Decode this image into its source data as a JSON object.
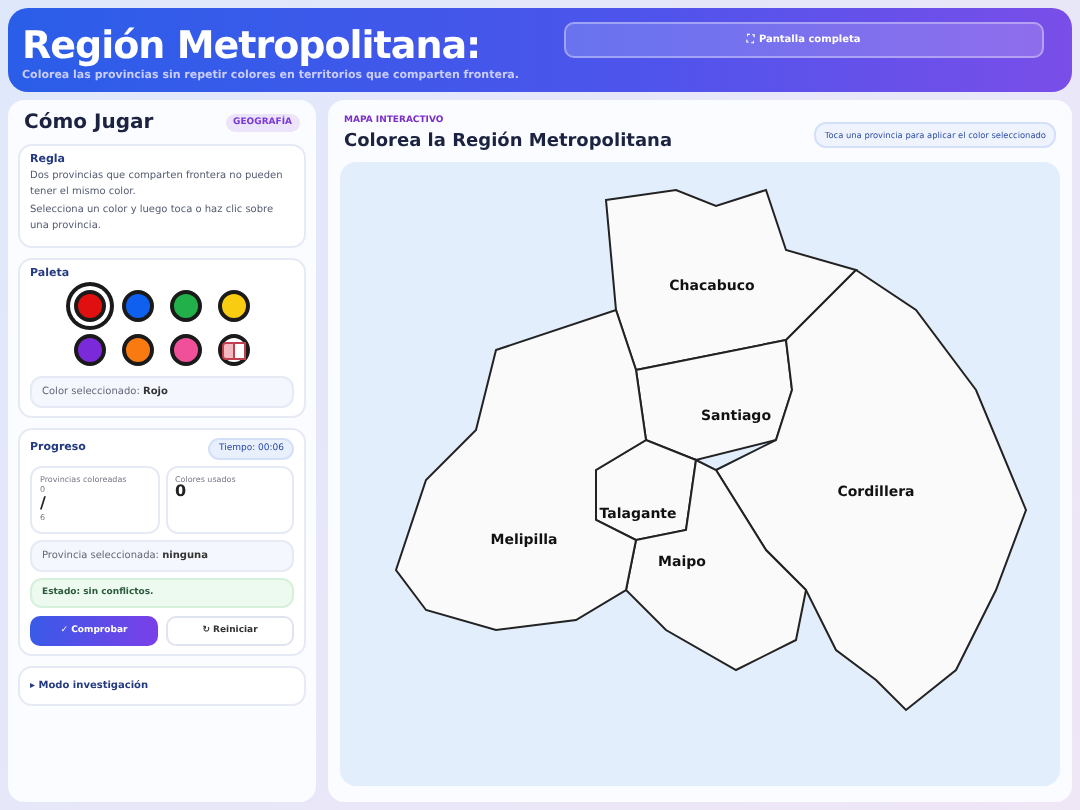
{
  "header": {
    "title": "Región Metropolitana:",
    "subtitle": "Colorea las provincias sin repetir colores en territorios que comparten frontera.",
    "fullscreen_button": "⛶ Pantalla completa"
  },
  "sidebar": {
    "title": "Cómo Jugar",
    "badge": "GEOGRAFÍA",
    "rule": {
      "heading": "Regla",
      "texts": [
        "Dos provincias que comparten frontera no pueden tener el mismo color.",
        "Selecciona un color y luego toca o haz clic sobre una provincia."
      ]
    },
    "palette": {
      "heading": "Paleta",
      "swatches": [
        {
          "kind": "color",
          "color": "#e01010",
          "selected": true
        },
        {
          "kind": "color",
          "color": "#1060f0",
          "selected": false
        },
        {
          "kind": "color",
          "color": "#22b04a",
          "selected": false
        },
        {
          "kind": "color",
          "color": "#f8cc10",
          "selected": false
        },
        {
          "kind": "color",
          "color": "#7a2ad8",
          "selected": false
        },
        {
          "kind": "color",
          "color": "#f87a10",
          "selected": false
        },
        {
          "kind": "color",
          "color": "#f0509a",
          "selected": false
        },
        {
          "kind": "eraser",
          "selected": false
        }
      ],
      "selected_label": "Color seleccionado:",
      "selected_value": "Rojo"
    },
    "progress": {
      "heading": "Progreso",
      "timer": "Tiempo: 00:06",
      "stats": [
        {
          "label": "Provincias coloreadas",
          "lines": [
            "0",
            "/",
            "6"
          ]
        },
        {
          "label": "Colores usados",
          "lines": [
            "0"
          ]
        }
      ],
      "province_label": "Provincia seleccionada:",
      "province_value": "ninguna",
      "status": "Estado: sin conflictos.",
      "check_button": "✓ Comprobar",
      "reset_button": "↻ Reiniciar"
    },
    "details": "▸ Modo investigación"
  },
  "map": {
    "kicker": "MAPA INTERACTIVO",
    "title": "Colorea la Región Metropolitana",
    "hint": "Toca una provincia para aplicar el color seleccionado",
    "provinces": [
      {
        "name": "Chacabuco"
      },
      {
        "name": "Santiago"
      },
      {
        "name": "Cordillera"
      },
      {
        "name": "Talagante"
      },
      {
        "name": "Maipo"
      },
      {
        "name": "Melipilla"
      }
    ]
  }
}
